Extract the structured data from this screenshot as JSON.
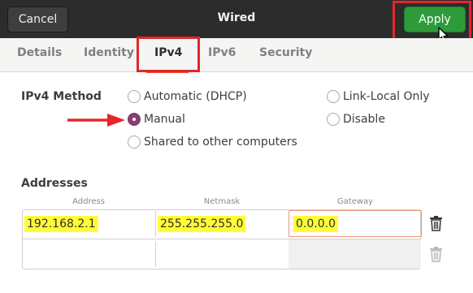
{
  "header": {
    "title": "Wired",
    "cancel_label": "Cancel",
    "apply_label": "Apply"
  },
  "tabs": [
    {
      "label": "Details",
      "active": false
    },
    {
      "label": "Identity",
      "active": false
    },
    {
      "label": "IPv4",
      "active": true
    },
    {
      "label": "IPv6",
      "active": false
    },
    {
      "label": "Security",
      "active": false
    }
  ],
  "ipv4": {
    "method_label": "IPv4 Method",
    "methods": [
      {
        "label": "Automatic (DHCP)",
        "selected": false
      },
      {
        "label": "Manual",
        "selected": true
      },
      {
        "label": "Shared to other computers",
        "selected": false
      },
      {
        "label": "Link-Local Only",
        "selected": false
      },
      {
        "label": "Disable",
        "selected": false
      }
    ]
  },
  "addresses": {
    "section_label": "Addresses",
    "columns": [
      "Address",
      "Netmask",
      "Gateway"
    ],
    "rows": [
      {
        "address": "192.168.2.1",
        "netmask": "255.255.255.0",
        "gateway": "0.0.0.0"
      },
      {
        "address": "",
        "netmask": "",
        "gateway": ""
      }
    ]
  },
  "colors": {
    "accent": "#e95420",
    "apply_green": "#2d9b3a",
    "radio_selected": "#8b3c74",
    "highlight_yellow": "#fffd38",
    "annotation_red": "#e3262b"
  },
  "icons": {
    "trash": "trash-icon",
    "cursor": "mouse-pointer-icon",
    "arrow": "red-arrow-annotation"
  }
}
